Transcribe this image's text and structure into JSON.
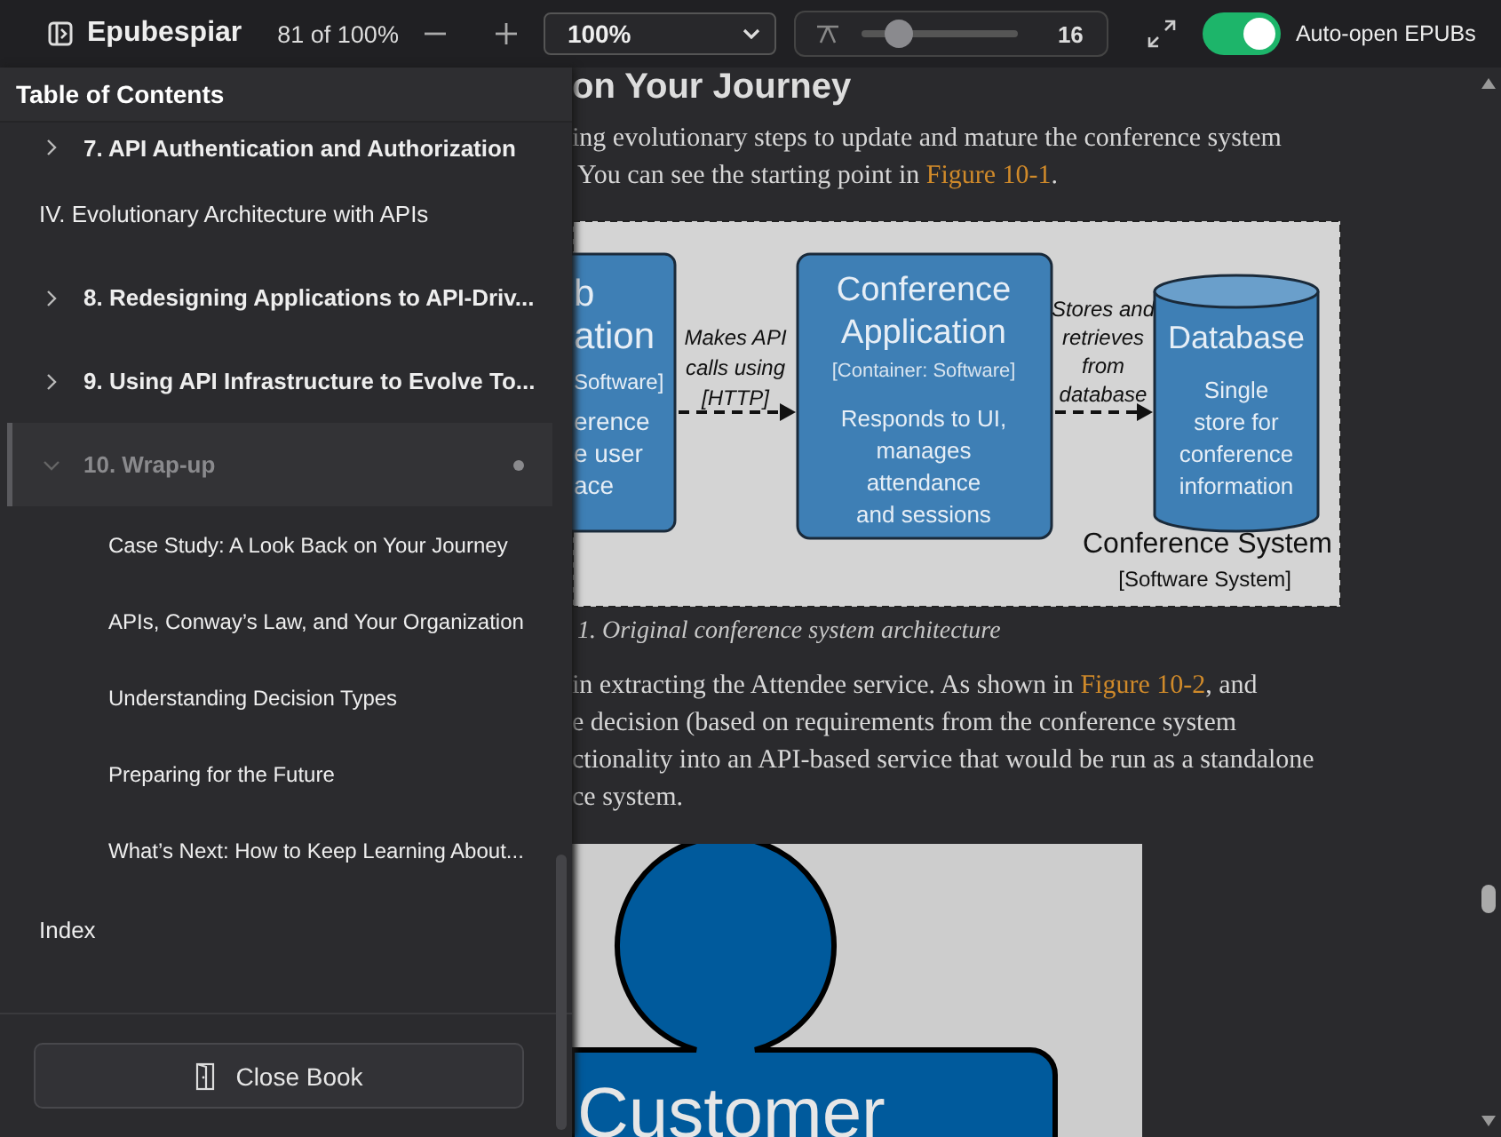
{
  "toolbar": {
    "app_title": "Epubespiar",
    "progress": "81 of 100%",
    "zoom": "100%",
    "font_size": {
      "level": 0.2,
      "reading": "16"
    },
    "auto_open": {
      "label": "Auto-open EPUBs",
      "on": true
    }
  },
  "toc": {
    "title": "Table of Contents",
    "items": [
      {
        "kind": "chapter",
        "label": "7. API Authentication and Authorization",
        "expanded": false,
        "selected": false
      },
      {
        "kind": "part",
        "label": "IV. Evolutionary Architecture with APIs",
        "selected": false
      },
      {
        "kind": "chapter",
        "label": "8. Redesigning Applications to API-Driv...",
        "expanded": false,
        "selected": false
      },
      {
        "kind": "chapter",
        "label": "9. Using API Infrastructure to Evolve To...",
        "expanded": false,
        "selected": false
      },
      {
        "kind": "chapter",
        "label": "10. Wrap-up",
        "expanded": true,
        "selected": true,
        "children": [
          {
            "label": "Case Study: A Look Back on Your Journey",
            "selected": false
          },
          {
            "label": "APIs, Conway’s Law, and Your Organization",
            "selected": false
          },
          {
            "label": "Understanding Decision Types",
            "selected": false
          },
          {
            "label": "Preparing for the Future",
            "selected": false
          },
          {
            "label": "What’s Next: How to Keep Learning About...",
            "selected": false
          }
        ]
      },
      {
        "kind": "part",
        "label": "Index",
        "selected": false
      }
    ],
    "close_button": "Close Book"
  },
  "content": {
    "heading": "on Your Journey",
    "paragraph_1": [
      {
        "text": "ing evolutionary steps to update and mature the conference system"
      },
      {
        "text": "You can see the starting point in ",
        "link": "Figure 10-1",
        "after": "."
      }
    ],
    "figure_1": {
      "left_box_lines": [
        "b",
        "ation",
        "Software]",
        "erence",
        "e user",
        "ace"
      ],
      "arrow_1_lines": [
        "Makes API",
        "calls using",
        "[HTTP]"
      ],
      "app_box": {
        "title_lines": [
          "Conference",
          "Application"
        ],
        "type": "[Container: Software]",
        "desc_lines": [
          "Responds to UI,",
          "manages",
          "attendance",
          "and sessions"
        ]
      },
      "arrow_2_lines": [
        "Stores and",
        "retrieves",
        "from",
        "database"
      ],
      "database": {
        "title": "Database",
        "desc_lines": [
          "Single",
          "store for",
          "conference",
          "information"
        ]
      },
      "boundary": {
        "title": "Conference System",
        "type": "[Software System]"
      }
    },
    "caption_1": "1. Original conference system architecture",
    "paragraph_2": [
      {
        "text": "in extracting the Attendee service. As shown in ",
        "link": "Figure 10-2",
        "after": ", and"
      },
      {
        "text": "e decision (based on requirements from the conference system"
      },
      {
        "text": "ctionality into an API-based service that would be run as a standalone"
      },
      {
        "text": "ce system."
      }
    ],
    "figure_2": {
      "label": "Customer"
    }
  }
}
